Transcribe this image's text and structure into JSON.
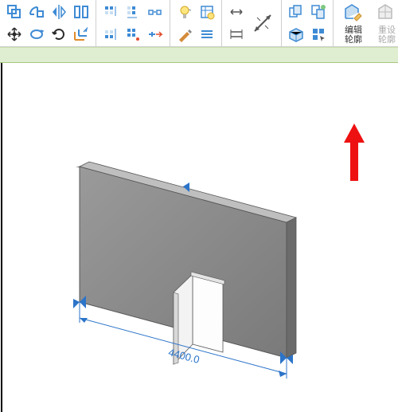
{
  "ribbon": {
    "group_modify": {
      "copy": "copy",
      "mirror": "mirror",
      "trim": "trim",
      "split": "split",
      "move": "move",
      "rotate": "rotate",
      "cycle": "cycle",
      "offset": "offset"
    },
    "group_align": {
      "align_tl": "align-top-left",
      "align_ml": "align-mid-left",
      "align_tr": "align-top-right",
      "align_bl": "align-bot-left",
      "align_bm": "align-bot-mid",
      "align_br": "align-bot-right",
      "array": "array",
      "pin": "pin"
    },
    "group_view": {
      "bulb": "visibility",
      "filter": "filter",
      "brush": "linework",
      "lines": "thin-lines"
    },
    "group_measure": {
      "measure": "measure",
      "dim": "dimension"
    },
    "group_create": {
      "create_similar": "create-similar",
      "load_family": "load-family",
      "select_all": "select-all",
      "reset": "reset"
    },
    "edit_profile": "编辑\n轮廓",
    "reset_profile": "重设\n轮廓"
  },
  "viewport": {
    "dimension_value": "4400.0"
  },
  "annotation": {
    "target": "edit-profile-button"
  }
}
